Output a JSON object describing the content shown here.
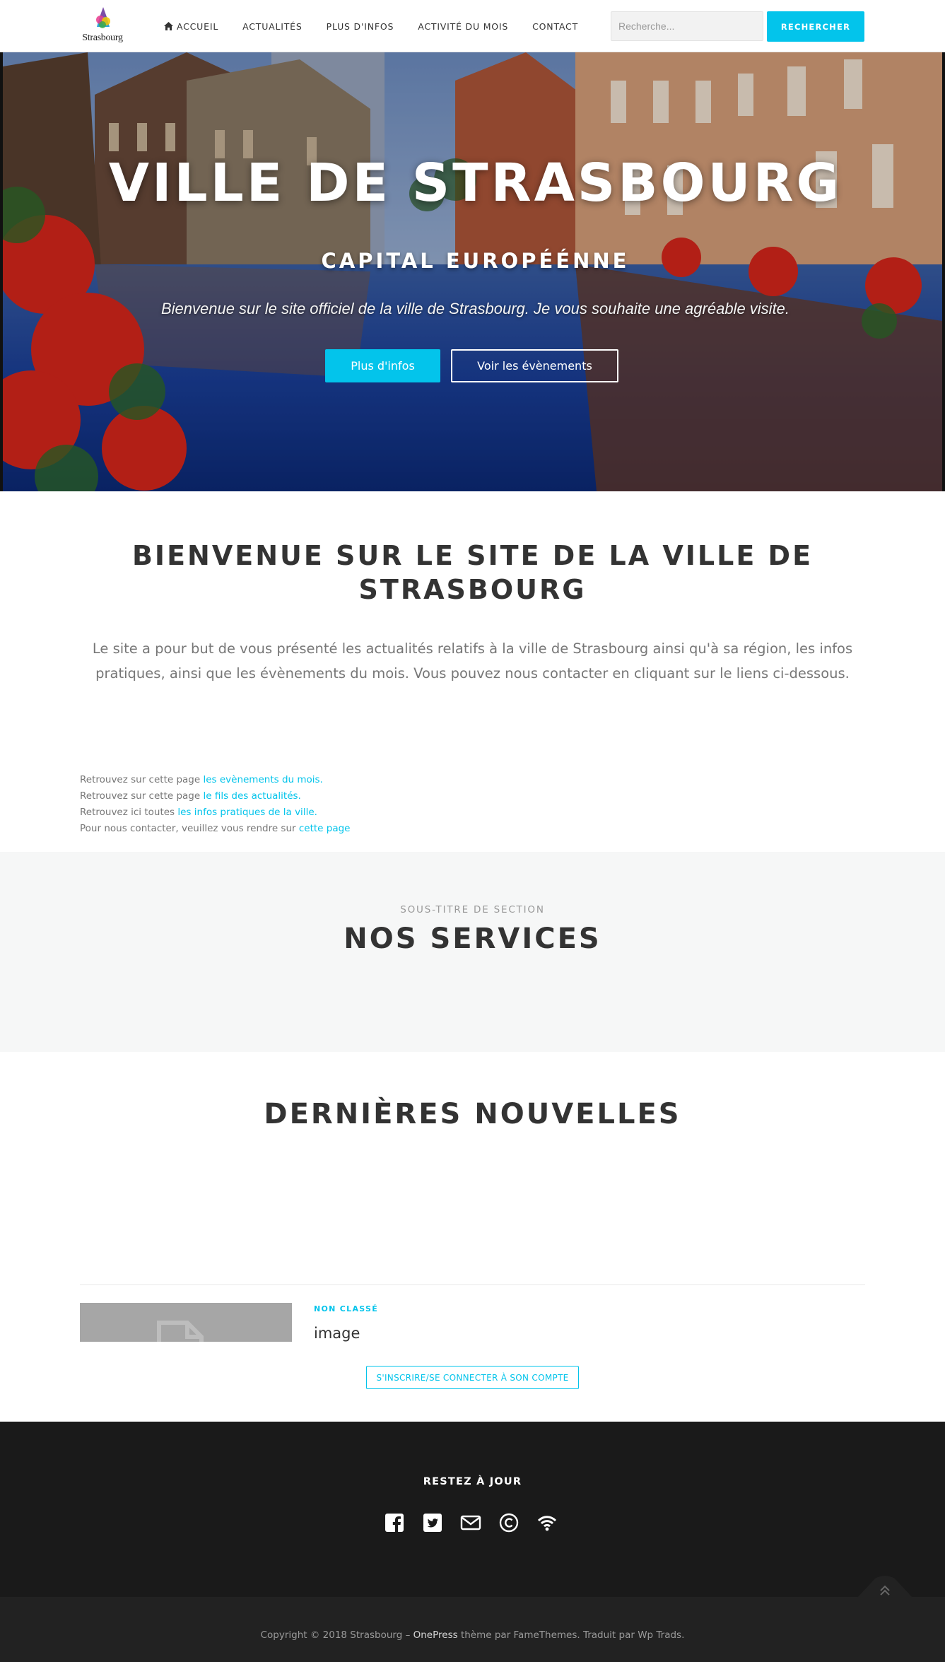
{
  "header": {
    "logo_text": "Strasbourg",
    "nav": [
      {
        "label": "Accueil",
        "icon": "home-icon"
      },
      {
        "label": "Actualités"
      },
      {
        "label": "Plus d'infos"
      },
      {
        "label": "Activité du mois"
      },
      {
        "label": "Contact"
      }
    ],
    "search": {
      "placeholder": "Recherche...",
      "button_label": "Rechercher"
    }
  },
  "hero": {
    "title": "VILLE DE STRASBOURG",
    "subtitle": "Capital Européénne",
    "description": "Bienvenue sur le site officiel de la ville de Strasbourg. Je vous souhaite une agréable visite.",
    "primary_button": "Plus d'infos",
    "secondary_button": "Voir les évènements"
  },
  "welcome": {
    "title": "Bienvenue sur le site de la ville de Strasbourg",
    "text": "Le site a pour but de vous présenté les actualités relatifs à la ville de Strasbourg ainsi qu'à sa région, les infos pratiques, ainsi que les évènements du mois. Vous pouvez nous contacter en cliquant sur le liens ci-dessous.",
    "links": [
      {
        "prefix": "Retrouvez sur cette page ",
        "link": "les evènements du mois."
      },
      {
        "prefix": "Retrouvez sur cette page ",
        "link": "le fils des actualités."
      },
      {
        "prefix": "Retrouvez ici toutes ",
        "link": "les infos pratiques de la ville."
      },
      {
        "prefix": "Pour nous contacter, veuillez vous rendre sur ",
        "link": "cette page"
      }
    ]
  },
  "services": {
    "kicker": "Sous-titre de section",
    "title": "Nos services"
  },
  "news": {
    "title": "Dernières Nouvelles",
    "post": {
      "category": "Non classé",
      "title": "image"
    },
    "login_button": "S'inscrire/Se connecter à son compte"
  },
  "footer": {
    "title": "Restez à jour",
    "social": [
      "facebook-icon",
      "twitter-icon",
      "email-icon",
      "copyright-icon",
      "rss-icon"
    ],
    "copyright_prefix": "Copyright © 2018 Strasbourg – ",
    "copyright_brand": "OnePress",
    "copyright_suffix": " thème par FameThemes. Traduit par Wp Trads."
  },
  "colors": {
    "accent": "#03c4eb",
    "text_dark": "#333333",
    "text_muted": "#777777",
    "footer_bg": "#1a1a1a",
    "footer_bottom_bg": "#222222",
    "services_bg": "#f6f7f7"
  }
}
